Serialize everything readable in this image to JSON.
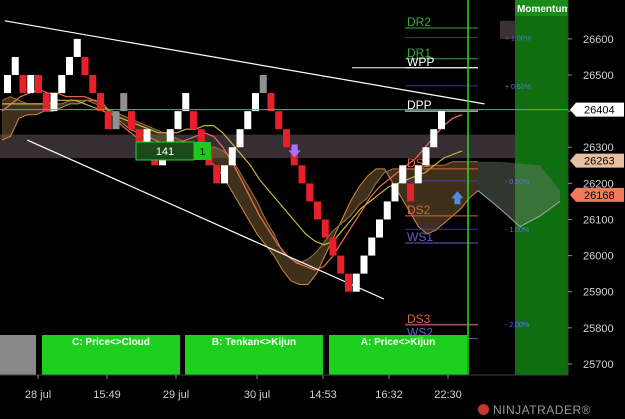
{
  "chart_data": {
    "type": "renko",
    "price_axis": {
      "min": 25650,
      "max": 26680,
      "ticks": [
        25700,
        25800,
        25900,
        26000,
        26100,
        26200,
        26300,
        26400,
        26500,
        26600
      ]
    },
    "time_labels": [
      "28 jul",
      "15:49",
      "29 jul",
      "30 jul",
      "14:53",
      "16:32",
      "22:30"
    ],
    "price_tags": [
      {
        "value": 26404,
        "label": "26404",
        "style": "last"
      },
      {
        "value": 26263,
        "label": "26263",
        "style": "tan"
      },
      {
        "value": 26168,
        "label": "26168",
        "style": "red"
      }
    ],
    "pivot_levels": [
      {
        "label": "DR2",
        "value": 26630,
        "color": "#3ca83c"
      },
      {
        "label": "DR1",
        "value": 26545,
        "color": "#3ca83c"
      },
      {
        "label": "WPP",
        "value": 26520,
        "color": "#ffffff"
      },
      {
        "label": "DPP",
        "value": 26400,
        "color": "#ffffff"
      },
      {
        "label": "DS1",
        "value": 26240,
        "color": "#e0603a"
      },
      {
        "label": "DS2",
        "value": 26110,
        "color": "#e0603a"
      },
      {
        "label": "WS1",
        "value": 26035,
        "color": "#6a5acd"
      },
      {
        "label": "DS3",
        "value": 25808,
        "color": "#e0603a"
      },
      {
        "label": "WS2",
        "value": 25770,
        "color": "#6a5acd"
      }
    ],
    "percent_levels": [
      {
        "label": "+ 1.00%",
        "value": 26604
      },
      {
        "label": "+ 0.50%",
        "value": 26470
      },
      {
        "label": "- 0.50%",
        "value": 26207
      },
      {
        "label": "- 1.00%",
        "value": 26073
      },
      {
        "label": "- 2.00%",
        "value": 25810
      }
    ],
    "bricks": [
      {
        "d": 1,
        "o": 26450,
        "c": 26500,
        "t": "hist"
      },
      {
        "d": 1,
        "o": 26500,
        "c": 26550,
        "t": "hist"
      },
      {
        "d": -1,
        "o": 26500,
        "c": 26450,
        "t": "hist"
      },
      {
        "d": 1,
        "o": 26450,
        "c": 26500,
        "t": "hist"
      },
      {
        "d": -1,
        "o": 26500,
        "c": 26450,
        "t": "hist"
      },
      {
        "d": -1,
        "o": 26450,
        "c": 26400,
        "t": "hist"
      },
      {
        "d": 1,
        "o": 26400,
        "c": 26450,
        "t": "hist"
      },
      {
        "d": 1,
        "o": 26450,
        "c": 26500,
        "t": "hist"
      },
      {
        "d": 1,
        "o": 26500,
        "c": 26550,
        "t": "hist"
      },
      {
        "d": 1,
        "o": 26550,
        "c": 26600,
        "t": "hist"
      },
      {
        "d": -1,
        "o": 26550,
        "c": 26500,
        "t": "hist"
      },
      {
        "d": -1,
        "o": 26500,
        "c": 26450,
        "t": "hist"
      },
      {
        "d": -1,
        "o": 26450,
        "c": 26400,
        "t": "hist"
      },
      {
        "d": -1,
        "o": 26400,
        "c": 26350,
        "t": "hist"
      },
      {
        "d": 1,
        "o": 26350,
        "c": 26400,
        "t": "hist"
      },
      {
        "d": 1,
        "o": 26400,
        "c": 26450,
        "t": "hist"
      },
      {
        "d": -1,
        "o": 26400,
        "c": 26350,
        "t": "hist"
      },
      {
        "d": -1,
        "o": 26350,
        "c": 26300,
        "t": "hist"
      },
      {
        "d": 1,
        "o": 26300,
        "c": 26350,
        "t": "hist"
      },
      {
        "d": -1,
        "o": 26300,
        "c": 26250,
        "t": "hist"
      },
      {
        "d": 1,
        "o": 26250,
        "c": 26300,
        "t": "hist"
      },
      {
        "d": 1,
        "o": 26300,
        "c": 26350,
        "t": "hist"
      },
      {
        "d": 1,
        "o": 26350,
        "c": 26400,
        "t": "hist"
      },
      {
        "d": 1,
        "o": 26400,
        "c": 26450,
        "t": "hist"
      },
      {
        "d": -1,
        "o": 26400,
        "c": 26350,
        "t": "hist"
      },
      {
        "d": -1,
        "o": 26350,
        "c": 26300,
        "t": "hist"
      },
      {
        "d": -1,
        "o": 26300,
        "c": 26250,
        "t": "hist"
      },
      {
        "d": -1,
        "o": 26250,
        "c": 26200,
        "t": "hist"
      },
      {
        "d": 1,
        "o": 26200,
        "c": 26250,
        "t": "hist"
      },
      {
        "d": 1,
        "o": 26250,
        "c": 26300,
        "t": "hist"
      },
      {
        "d": 1,
        "o": 26300,
        "c": 26350,
        "t": "hist"
      },
      {
        "d": 1,
        "o": 26350,
        "c": 26400,
        "t": "hist"
      },
      {
        "d": 1,
        "o": 26400,
        "c": 26450,
        "t": "hist"
      },
      {
        "d": 1,
        "o": 26450,
        "c": 26500,
        "t": "hist"
      },
      {
        "d": -1,
        "o": 26450,
        "c": 26400,
        "t": "hist"
      },
      {
        "d": -1,
        "o": 26400,
        "c": 26350,
        "t": "hist"
      },
      {
        "d": -1,
        "o": 26350,
        "c": 26300,
        "t": "hist"
      },
      {
        "d": -1,
        "o": 26300,
        "c": 26250,
        "t": "hist"
      },
      {
        "d": -1,
        "o": 26250,
        "c": 26200,
        "t": "hist"
      },
      {
        "d": -1,
        "o": 26200,
        "c": 26150,
        "t": "hist"
      },
      {
        "d": -1,
        "o": 26150,
        "c": 26100,
        "t": "hist"
      },
      {
        "d": -1,
        "o": 26100,
        "c": 26050,
        "t": "hist"
      },
      {
        "d": -1,
        "o": 26050,
        "c": 26000,
        "t": "hist"
      },
      {
        "d": -1,
        "o": 26000,
        "c": 25950,
        "t": "hist"
      },
      {
        "d": -1,
        "o": 25950,
        "c": 25900,
        "t": "hist"
      },
      {
        "d": 1,
        "o": 25900,
        "c": 25950,
        "t": "hist"
      },
      {
        "d": 1,
        "o": 25950,
        "c": 26000,
        "t": "hist"
      },
      {
        "d": 1,
        "o": 26000,
        "c": 26050,
        "t": "hist"
      },
      {
        "d": 1,
        "o": 26050,
        "c": 26100,
        "t": "hist"
      },
      {
        "d": 1,
        "o": 26100,
        "c": 26150,
        "t": "hist"
      },
      {
        "d": 1,
        "o": 26150,
        "c": 26200,
        "t": "hist"
      },
      {
        "d": 1,
        "o": 26200,
        "c": 26250,
        "t": "hist"
      },
      {
        "d": -1,
        "o": 26200,
        "c": 26150,
        "t": "hist"
      },
      {
        "d": 1,
        "o": 26200,
        "c": 26250,
        "t": "hist"
      },
      {
        "d": 1,
        "o": 26250,
        "c": 26300,
        "t": "hist"
      },
      {
        "d": 1,
        "o": 26300,
        "c": 26350,
        "t": "hist"
      },
      {
        "d": 1,
        "o": 26350,
        "c": 26400,
        "t": "hist"
      }
    ],
    "cloud_series": {
      "span_a": [
        26320,
        26330,
        26380,
        26390,
        26390,
        26400,
        26400,
        26410,
        26420,
        26420,
        26430,
        26430,
        26410,
        26390,
        26370,
        26350,
        26340,
        26330,
        26320,
        26310,
        26300,
        26300,
        26290,
        26280,
        26270,
        26250,
        26220,
        26180,
        26140,
        26100,
        26060,
        26030,
        26000,
        25960,
        25930,
        25920,
        25920,
        25950,
        26000,
        26050,
        26100,
        26150,
        26190,
        26220,
        26240,
        26240,
        26200,
        26160,
        26120,
        26080,
        26060,
        26070,
        26090,
        26110,
        26130,
        26160,
        26180
      ],
      "span_b": [
        26430,
        26440,
        26430,
        26420,
        26420,
        26420,
        26420,
        26420,
        26430,
        26430,
        26430,
        26420,
        26410,
        26400,
        26390,
        26380,
        26370,
        26360,
        26350,
        26340,
        26330,
        26320,
        26310,
        26300,
        26300,
        26300,
        26290,
        26270,
        26230,
        26190,
        26150,
        26100,
        26060,
        26010,
        25990,
        25980,
        25990,
        26010,
        26040,
        26070,
        26090,
        26110,
        26140,
        26160,
        26200,
        26230,
        26240,
        26240,
        26240,
        26240,
        26250,
        26250,
        26250,
        26260,
        26260,
        26260,
        26260
      ],
      "line_orange": [
        26400,
        26420,
        26440,
        26450,
        26460,
        26450,
        26450,
        26440,
        26440,
        26440,
        26430,
        26420,
        26390,
        26360,
        26340,
        26320,
        26310,
        26300,
        26300,
        26310,
        26320,
        26330,
        26340,
        26330,
        26300,
        26260,
        26210,
        26160,
        26110,
        26070,
        26030,
        26000,
        25980,
        25970,
        25960,
        25970,
        26000,
        26040,
        26080,
        26120,
        26160,
        26190,
        26210,
        26230,
        26250,
        26270,
        26300,
        26330,
        26360,
        26380,
        26390
      ],
      "line_olive": [
        26420,
        26420,
        26420,
        26420,
        26420,
        26420,
        26430,
        26430,
        26430,
        26420,
        26410,
        26400,
        26390,
        26380,
        26370,
        26360,
        26350,
        26340,
        26340,
        26340,
        26350,
        26350,
        26360,
        26360,
        26340,
        26310,
        26280,
        26250,
        26210,
        26180,
        26150,
        26120,
        26090,
        26060,
        26040,
        26030,
        26040,
        26070,
        26100,
        26130,
        26150,
        26170,
        26190,
        26200,
        26210,
        26220,
        26230,
        26250,
        26270,
        26280,
        26290
      ]
    },
    "trendlines": [
      {
        "from": [
          0.1,
          26650
        ],
        "to": [
          62,
          26420
        ]
      },
      {
        "from": [
          3,
          26320
        ],
        "to": [
          49,
          25880
        ]
      }
    ],
    "boxes": [
      {
        "label": "141",
        "type": "count"
      },
      {
        "label": "1",
        "type": "count-small"
      }
    ],
    "arrows": [
      {
        "index": 37.5,
        "value": 26280,
        "dir": "down",
        "color": "#b070ff"
      },
      {
        "index": 58.5,
        "value": 26170,
        "dir": "up",
        "color": "#4a8fe0"
      }
    ],
    "side_panel": {
      "title": "Momentum"
    },
    "buttons": [
      {
        "label": ""
      },
      {
        "label": "C: Price<>Cloud"
      },
      {
        "label": "B: Tenkan<>Kijun"
      },
      {
        "label": "A: Price<>Kijun"
      }
    ]
  },
  "brand": {
    "text": "NINJATRADER",
    "mark": "®"
  },
  "colors": {
    "bull_brick": "#ffffff",
    "bear_brick": "#e8202a",
    "hist_bull": "#ffffff",
    "accent_green": "#00c800",
    "momentum_green": "#0f6e10"
  }
}
